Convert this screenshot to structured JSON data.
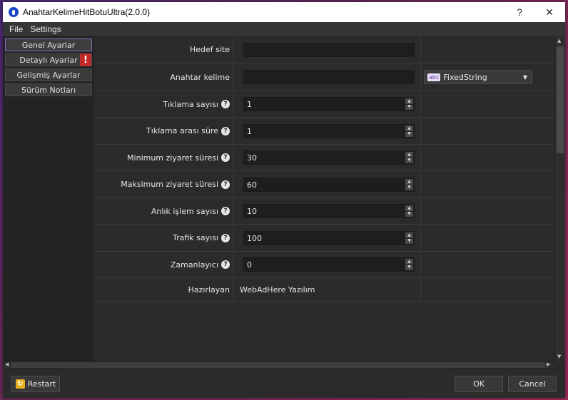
{
  "window": {
    "title": "AnahtarKelimeHitBotuUltra(2.0.0)",
    "help_glyph": "?",
    "close_glyph": "✕"
  },
  "menu": {
    "file": "File",
    "settings": "Settings"
  },
  "sidebar": {
    "items": [
      {
        "label": "Genel Ayarlar"
      },
      {
        "label": "Detaylı Ayarlar",
        "badge": "!"
      },
      {
        "label": "Gelişmiş Ayarlar"
      },
      {
        "label": "Sürüm Notları"
      }
    ]
  },
  "form": {
    "hedef_site": {
      "label": "Hedef site",
      "value": ""
    },
    "anahtar_kelime": {
      "label": "Anahtar kelime",
      "value": "",
      "type_icon": "abc",
      "type_value": "FixedString"
    },
    "tiklama_sayisi": {
      "label": "Tıklama sayısı",
      "value": "1"
    },
    "tiklama_arasi_sure": {
      "label": "Tıklama arası süre",
      "value": "1"
    },
    "min_ziyaret": {
      "label": "Minimum ziyaret süresi",
      "value": "30"
    },
    "max_ziyaret": {
      "label": "Maksimum ziyaret süresi",
      "value": "60"
    },
    "anlik_islem": {
      "label": "Anlık işlem sayısı",
      "value": "10"
    },
    "trafik_sayisi": {
      "label": "Trafik sayısı",
      "value": "100"
    },
    "zamanlayici": {
      "label": "Zamanlayıcı",
      "value": "0"
    },
    "hazirlayan": {
      "label": "Hazırlayan",
      "value": "WebAdHere Yazılım"
    }
  },
  "footer": {
    "restart": "Restart",
    "ok": "OK",
    "cancel": "Cancel"
  },
  "colors": {
    "accent": "#8a6fc8",
    "warning": "#c02a2a",
    "background": "#2b2b2b"
  }
}
